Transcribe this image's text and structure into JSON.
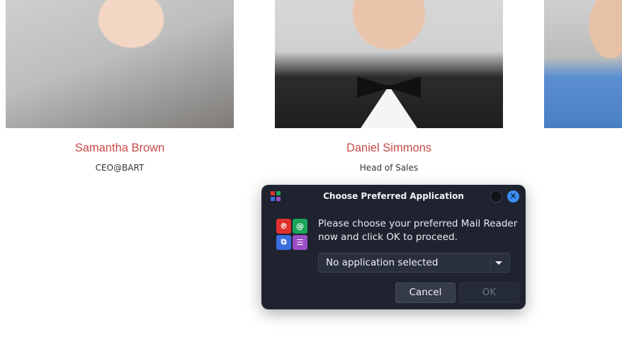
{
  "team": [
    {
      "name": "Samantha Brown",
      "role": "CEO@BART"
    },
    {
      "name": "Daniel Simmons",
      "role": "Head of Sales"
    }
  ],
  "dialog": {
    "title": "Choose Preferred Application",
    "message_line1": "Please choose your preferred Mail Reader",
    "message_line2": "now and click OK to proceed.",
    "select_value": "No application selected",
    "cancel_label": "Cancel",
    "ok_label": "OK",
    "close_glyph": "✕",
    "icons": {
      "small_app_icon": "app-grid-icon",
      "big_icon": "mail-reader-icon",
      "tile_glyphs": [
        "℗",
        "@",
        "⧉",
        "☰"
      ]
    }
  },
  "colors": {
    "name_accent": "#c84a45",
    "dialog_bg": "#1f2330",
    "close_button": "#3a8ef6",
    "tile_red": "#e0312f",
    "tile_green": "#19a55a",
    "tile_blue": "#3a6fe0",
    "tile_purple": "#9b4fc6"
  }
}
